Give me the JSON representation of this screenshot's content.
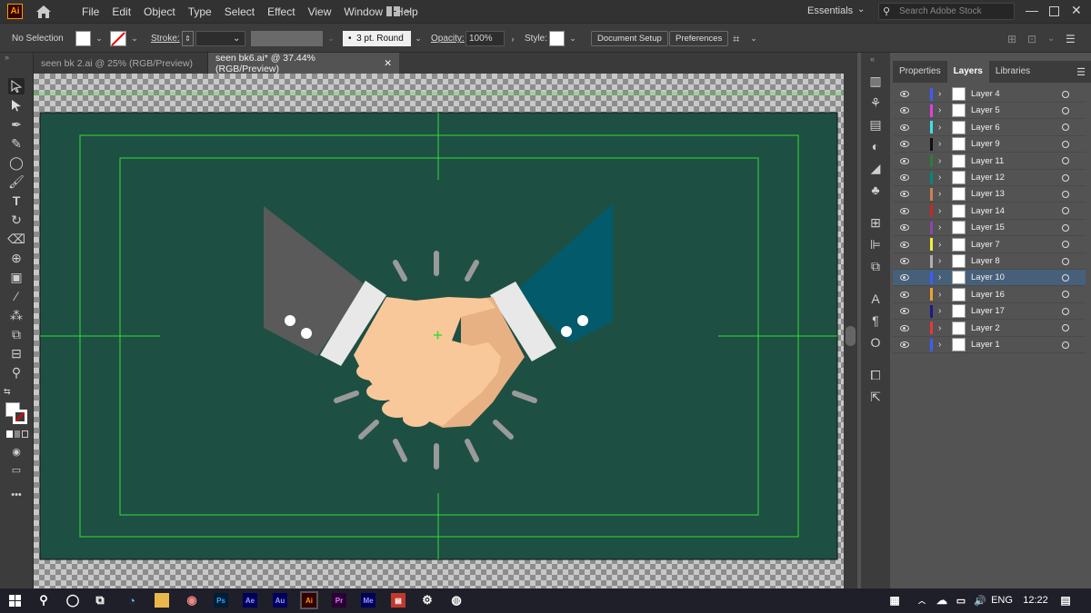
{
  "app": {
    "logo": "Ai",
    "menus": [
      "File",
      "Edit",
      "Object",
      "Type",
      "Select",
      "Effect",
      "View",
      "Window",
      "Help"
    ],
    "workspace": "Essentials",
    "search_placeholder": "Search Adobe Stock"
  },
  "control": {
    "selection": "No Selection",
    "stroke_label": "Stroke:",
    "brush": "3 pt. Round",
    "opacity_label": "Opacity:",
    "opacity": "100%",
    "style_label": "Style:",
    "doc_setup": "Document Setup",
    "preferences": "Preferences"
  },
  "tabs": [
    {
      "label": "seen bk 2.ai @ 25% (RGB/Preview)"
    },
    {
      "label": "seen bk6.ai* @ 37.44% (RGB/Preview)"
    }
  ],
  "panel": {
    "tabs": [
      "Properties",
      "Layers",
      "Libraries"
    ],
    "active_tab": "Layers"
  },
  "layers": [
    {
      "name": "Layer 4",
      "color": "#3d5cff"
    },
    {
      "name": "Layer 5",
      "color": "#e040e0"
    },
    {
      "name": "Layer 6",
      "color": "#40e0e0"
    },
    {
      "name": "Layer 9",
      "color": "#101010"
    },
    {
      "name": "Layer 11",
      "color": "#2e7d32"
    },
    {
      "name": "Layer 12",
      "color": "#00897b"
    },
    {
      "name": "Layer 13",
      "color": "#d08050"
    },
    {
      "name": "Layer 14",
      "color": "#c62828"
    },
    {
      "name": "Layer 15",
      "color": "#8e44ad"
    },
    {
      "name": "Layer 7",
      "color": "#f0f040"
    },
    {
      "name": "Layer 8",
      "color": "#b0b0b0"
    },
    {
      "name": "Layer 10",
      "color": "#3d5cff",
      "selected": true
    },
    {
      "name": "Layer 16",
      "color": "#f0a030"
    },
    {
      "name": "Layer 17",
      "color": "#1a1a8a"
    },
    {
      "name": "Layer 2",
      "color": "#e53935"
    },
    {
      "name": "Layer 1",
      "color": "#3d5cff"
    }
  ],
  "taskbar": {
    "lang": "ENG",
    "time": "12:22",
    "apps": [
      "Ps",
      "Ae",
      "Au",
      "Ai",
      "Pr",
      "Me"
    ]
  },
  "colors": {
    "artboard": "#1e4f43",
    "guide": "#33dd33",
    "dark_sleeve": "#5a5a5a",
    "blue_sleeve": "#035a6b",
    "skin": "#f9c89a",
    "skin_dark": "#e8b184"
  }
}
